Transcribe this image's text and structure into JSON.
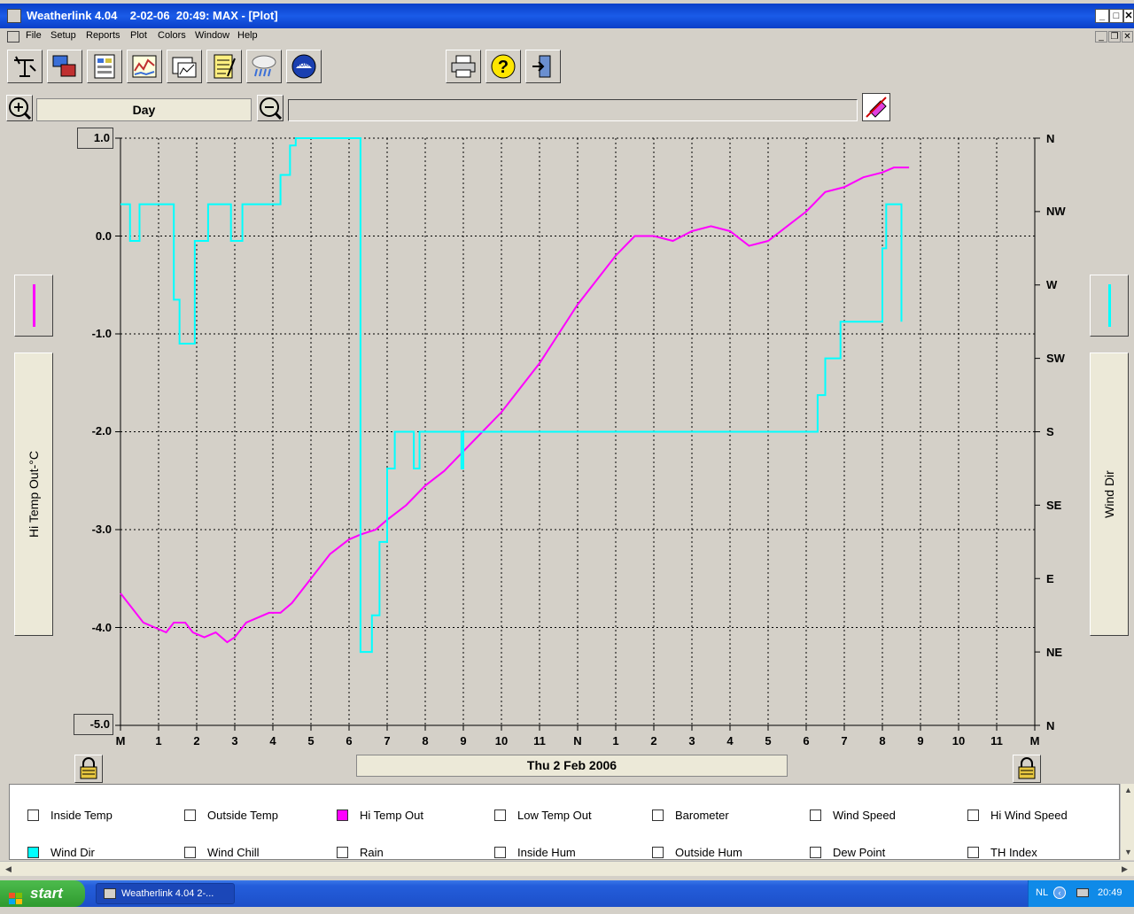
{
  "window": {
    "title": "Weatherlink 4.04    2-02-06  20:49: MAX - [Plot]"
  },
  "menu": [
    "File",
    "Setup",
    "Reports",
    "Plot",
    "Colors",
    "Window",
    "Help"
  ],
  "toolbar": {
    "icons": [
      "station-icon",
      "download-icon",
      "bulletin-icon",
      "strip-chart-icon",
      "graph-icon",
      "notes-icon",
      "weather-icon",
      "noaa-icon",
      "print-icon",
      "help-icon",
      "exit-icon"
    ]
  },
  "period": {
    "label": "Day"
  },
  "plot": {
    "left_axis_label": "Hi Temp Out-°C",
    "right_axis_label": "Wind Dir",
    "left_top_value": "1.0",
    "left_bottom_value": "-5.0",
    "left_ticks": [
      "0.0",
      "-1.0",
      "-2.0",
      "-3.0",
      "-4.0"
    ],
    "right_ticks": [
      "N",
      "NW",
      "W",
      "SW",
      "S",
      "SE",
      "E",
      "NE",
      "N"
    ],
    "x_ticks": [
      "M",
      "1",
      "2",
      "3",
      "4",
      "5",
      "6",
      "7",
      "8",
      "9",
      "10",
      "11",
      "N",
      "1",
      "2",
      "3",
      "4",
      "5",
      "6",
      "7",
      "8",
      "9",
      "10",
      "11",
      "M"
    ],
    "date_label": "Thu 2 Feb 2006"
  },
  "chart_data": {
    "type": "line",
    "title": "",
    "xlabel": "",
    "ylabel": "Hi Temp Out-°C",
    "y2label": "Wind Dir",
    "xlim": [
      0,
      24
    ],
    "ylim": [
      -5,
      1
    ],
    "y2_ticks": [
      "N",
      "NE",
      "E",
      "SE",
      "S",
      "SW",
      "W",
      "NW",
      "N"
    ],
    "grid": true,
    "series": [
      {
        "name": "Hi Temp Out",
        "color": "#ff00ff",
        "axis": "left",
        "x": [
          0,
          0.3,
          0.6,
          0.9,
          1.2,
          1.4,
          1.7,
          1.9,
          2.2,
          2.5,
          2.8,
          3.0,
          3.3,
          3.6,
          3.9,
          4.2,
          4.5,
          5.0,
          5.5,
          6.0,
          6.3,
          6.7,
          7.0,
          7.5,
          8.0,
          8.5,
          9.0,
          9.5,
          10.0,
          10.5,
          11.0,
          11.5,
          12.0,
          12.5,
          13.0,
          13.5,
          14.0,
          14.5,
          15.0,
          15.5,
          16.0,
          16.5,
          17.0,
          17.5,
          18.0,
          18.5,
          19.0,
          19.5,
          20.0,
          20.3,
          20.7
        ],
        "values": [
          -3.65,
          -3.8,
          -3.95,
          -4.0,
          -4.05,
          -3.95,
          -3.95,
          -4.05,
          -4.1,
          -4.05,
          -4.15,
          -4.1,
          -3.95,
          -3.9,
          -3.85,
          -3.85,
          -3.75,
          -3.5,
          -3.25,
          -3.1,
          -3.05,
          -3.0,
          -2.9,
          -2.75,
          -2.55,
          -2.4,
          -2.2,
          -2.0,
          -1.8,
          -1.55,
          -1.3,
          -1.0,
          -0.7,
          -0.45,
          -0.2,
          0.0,
          0.0,
          -0.05,
          0.05,
          0.1,
          0.05,
          -0.1,
          -0.05,
          0.1,
          0.25,
          0.45,
          0.5,
          0.6,
          0.65,
          0.7,
          0.7
        ]
      },
      {
        "name": "Wind Dir",
        "color": "#00ffff",
        "axis": "right",
        "x": [
          0,
          0.1,
          0.25,
          0.35,
          0.5,
          0.75,
          1.25,
          1.4,
          1.55,
          1.7,
          1.95,
          2.1,
          2.3,
          2.6,
          2.9,
          3.2,
          3.5,
          3.8,
          4.0,
          4.2,
          4.45,
          4.6,
          5.0,
          5.5,
          6.0,
          6.25,
          6.3,
          6.45,
          6.6,
          6.8,
          7.0,
          7.2,
          7.4,
          7.7,
          7.85,
          8.0,
          8.3,
          8.5,
          8.95,
          9.0,
          9.5,
          10.0,
          11.0,
          12.0,
          13.0,
          14.0,
          14.4,
          14.5,
          15.0,
          16.0,
          17.0,
          18.0,
          18.3,
          18.5,
          18.9,
          19.3,
          19.6,
          20.0,
          20.1,
          20.4,
          20.5
        ],
        "values": [
          7.1,
          7.1,
          6.6,
          6.6,
          7.1,
          7.1,
          7.1,
          5.8,
          5.2,
          5.2,
          6.6,
          6.6,
          7.1,
          7.1,
          6.6,
          7.1,
          7.1,
          7.1,
          7.1,
          7.5,
          7.9,
          8.0,
          8.0,
          8.0,
          8.0,
          8.0,
          1.0,
          1.0,
          1.5,
          2.5,
          3.5,
          4.0,
          4.0,
          3.5,
          4.0,
          4.0,
          4.0,
          4.0,
          3.5,
          4.0,
          4.0,
          4.0,
          4.0,
          4.0,
          4.0,
          4.0,
          4.0,
          4.0,
          4.0,
          4.0,
          4.0,
          4.0,
          4.5,
          5.0,
          5.5,
          5.5,
          5.5,
          6.5,
          7.1,
          7.1,
          5.5
        ]
      }
    ]
  },
  "legend": [
    {
      "label": "Inside Temp",
      "checked": false,
      "color": ""
    },
    {
      "label": "Outside Temp",
      "checked": false,
      "color": ""
    },
    {
      "label": "Hi Temp Out",
      "checked": true,
      "color": "#ff00ff"
    },
    {
      "label": "Low Temp Out",
      "checked": false,
      "color": ""
    },
    {
      "label": "Barometer",
      "checked": false,
      "color": ""
    },
    {
      "label": "Wind Speed",
      "checked": false,
      "color": ""
    },
    {
      "label": "Hi Wind Speed",
      "checked": false,
      "color": ""
    },
    {
      "label": "Wind Dir",
      "checked": true,
      "color": "#00ffff"
    },
    {
      "label": "Wind Chill",
      "checked": false,
      "color": ""
    },
    {
      "label": "Rain",
      "checked": false,
      "color": ""
    },
    {
      "label": "Inside Hum",
      "checked": false,
      "color": ""
    },
    {
      "label": "Outside Hum",
      "checked": false,
      "color": ""
    },
    {
      "label": "Dew Point",
      "checked": false,
      "color": ""
    },
    {
      "label": "TH Index",
      "checked": false,
      "color": ""
    }
  ],
  "taskbar": {
    "start": "start",
    "task": "Weatherlink 4.04   2-...",
    "lang": "NL",
    "clock": "20:49"
  }
}
